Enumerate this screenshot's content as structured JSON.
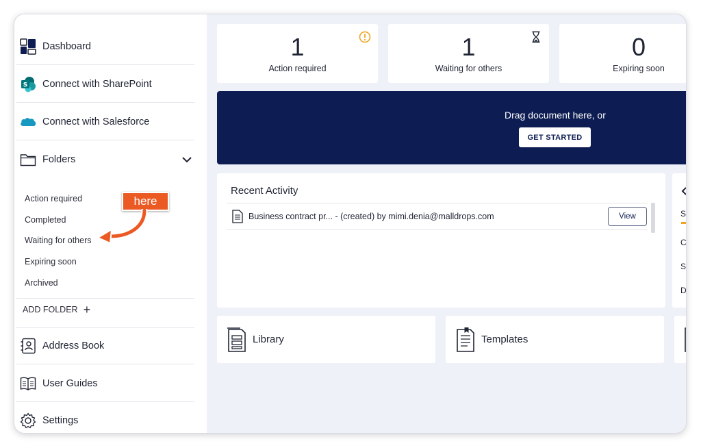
{
  "sidebar": {
    "dashboard": "Dashboard",
    "sharepoint": "Connect with SharePoint",
    "salesforce": "Connect with Salesforce",
    "folders": "Folders",
    "folder_items": [
      "Action required",
      "Completed",
      "Waiting for others",
      "Expiring soon",
      "Archived"
    ],
    "add_folder": "ADD FOLDER",
    "add_folder_plus": "+",
    "address_book": "Address Book",
    "user_guides": "User Guides",
    "settings": "Settings"
  },
  "annotation": {
    "label": "here",
    "color": "#ec5a24"
  },
  "stats": [
    {
      "value": "1",
      "caption": "Action required"
    },
    {
      "value": "1",
      "caption": "Waiting for others"
    },
    {
      "value": "0",
      "caption": "Expiring soon"
    }
  ],
  "upload": {
    "prompt": "Drag document here, or",
    "button": "GET STARTED"
  },
  "recent_activity": {
    "title": "Recent Activity",
    "rows": [
      {
        "text": "Business contract pr... - (created) by mimi.denia@malldrops.com",
        "action": "View"
      }
    ]
  },
  "side_panel_letters": [
    "S",
    "C",
    "S",
    "D"
  ],
  "tiles": [
    {
      "label": "Library"
    },
    {
      "label": "Templates"
    }
  ],
  "colors": {
    "navy": "#0d1c52",
    "accent_orange": "#f0a420",
    "annotation": "#ec5a24",
    "background": "#eef1f8"
  }
}
